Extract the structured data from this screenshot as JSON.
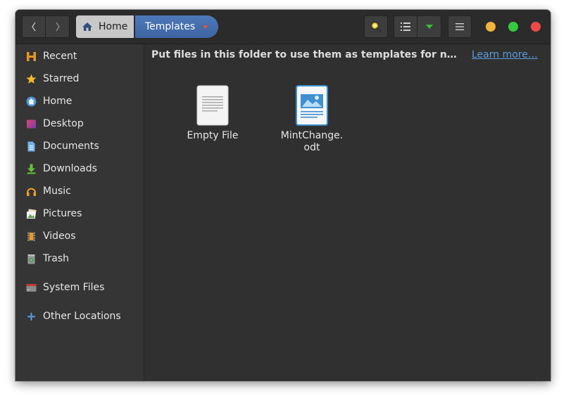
{
  "header": {
    "breadcrumb_home": "Home",
    "breadcrumb_current": "Templates"
  },
  "sidebar": {
    "items": [
      {
        "label": "Recent",
        "icon": "recent-icon"
      },
      {
        "label": "Starred",
        "icon": "star-icon"
      },
      {
        "label": "Home",
        "icon": "home-icon"
      },
      {
        "label": "Desktop",
        "icon": "desktop-icon"
      },
      {
        "label": "Documents",
        "icon": "documents-icon"
      },
      {
        "label": "Downloads",
        "icon": "downloads-icon"
      },
      {
        "label": "Music",
        "icon": "music-icon"
      },
      {
        "label": "Pictures",
        "icon": "pictures-icon"
      },
      {
        "label": "Videos",
        "icon": "videos-icon"
      },
      {
        "label": "Trash",
        "icon": "trash-icon"
      },
      {
        "label": "System Files",
        "icon": "drive-icon"
      },
      {
        "label": "Other Locations",
        "icon": "plus-icon"
      }
    ]
  },
  "content": {
    "info_text": "Put files in this folder to use them as templates for new documents.",
    "info_link": "Learn more…",
    "files": [
      {
        "name": "Empty File",
        "icon": "text-file-icon"
      },
      {
        "name": "MintChange.\nodt",
        "icon": "writer-document-icon"
      }
    ]
  },
  "colors": {
    "accent": "#3e65a3",
    "window_bg": "#303030",
    "sidebar_bg": "#353535",
    "close": "#ef4a4a",
    "minimize": "#f0b43c",
    "maximize": "#35c93f",
    "link": "#5b9be0"
  }
}
